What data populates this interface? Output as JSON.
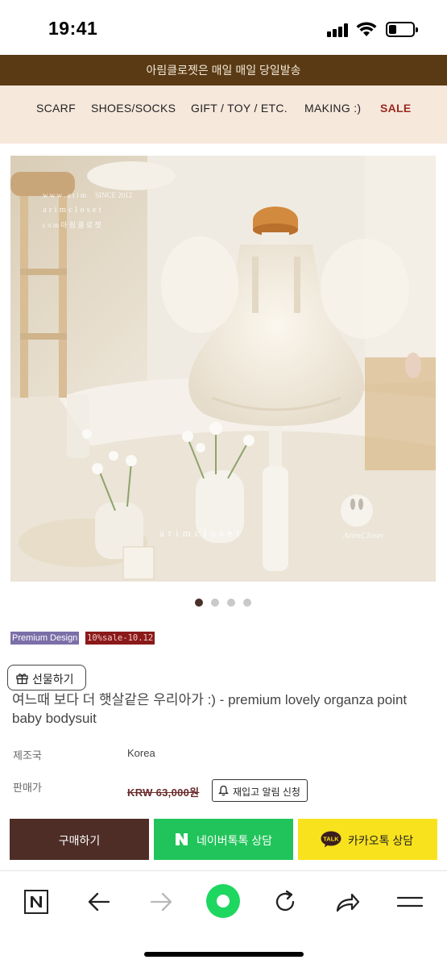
{
  "status_bar": {
    "time": "19:41",
    "icons": [
      "signal-icon",
      "wifi-icon",
      "battery-icon"
    ]
  },
  "banner": {
    "text": "아림클로젯은 매일 매일 당일발송"
  },
  "nav": {
    "items": [
      {
        "label": "SCARF"
      },
      {
        "label": "SHOES/SOCKS"
      },
      {
        "label": "GIFT / TOY / ETC."
      },
      {
        "label": "MAKING :)"
      },
      {
        "label": "SALE"
      }
    ]
  },
  "product_image": {
    "watermark_top": [
      "w w w . a r i m",
      "SINCE 2012",
      "arimcloset",
      "c o m 아 림 클 로 젯"
    ],
    "watermark_bottom": "arimcloset",
    "logo_text": "ArimCloset",
    "carousel": {
      "count": 4,
      "active_index": 0
    }
  },
  "badges": {
    "premium": "Premium Design",
    "sale": "10%sale-10.12"
  },
  "gift_button": {
    "label": "선물하기",
    "icon": "gift-icon"
  },
  "product": {
    "title": "여느때 보다 더 햇살같은 우리아가 :) - premium lovely organza point baby bodysuit",
    "origin_label": "제조국",
    "origin_value": "Korea",
    "price_label": "판매가",
    "price_value": "KRW 63,000원"
  },
  "restock_button": {
    "label": "재입고 알림 신청",
    "icon": "bell-icon"
  },
  "actions": {
    "buy": "구매하기",
    "naver": "네이버톡톡 상담",
    "kakao": "카카오톡 상담",
    "kakao_icon_text": "TALK"
  },
  "colors": {
    "banner": "#5a3a14",
    "nav_bg": "#f7e8dc",
    "sale": "#9a2a20",
    "buy": "#4e2d27",
    "naver": "#21c45a",
    "kakao": "#f8e21e",
    "toolbar_accent": "#1ed760"
  },
  "toolbar": {
    "items": [
      "naver-n-icon",
      "back-arrow-icon",
      "forward-arrow-icon",
      "green-home-icon",
      "refresh-icon",
      "share-icon",
      "menu-icon"
    ]
  }
}
